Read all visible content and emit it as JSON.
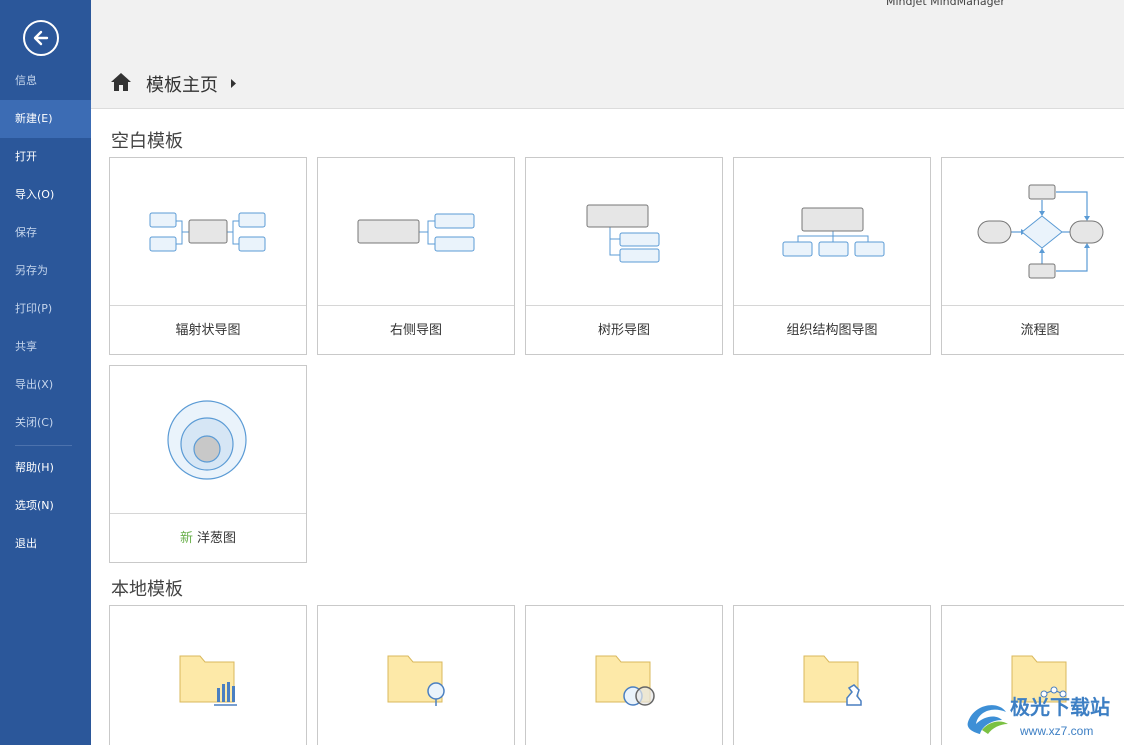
{
  "app": {
    "title": "Mindjet MindManager"
  },
  "sidebar": {
    "back_icon": "back-arrow-icon",
    "items": [
      {
        "label": "信息",
        "state": "dim"
      },
      {
        "label": "新建(E)",
        "state": "active"
      },
      {
        "label": "打开",
        "state": "normal"
      },
      {
        "label": "导入(O)",
        "state": "normal"
      },
      {
        "label": "保存",
        "state": "dim"
      },
      {
        "label": "另存为",
        "state": "dim"
      },
      {
        "label": "打印(P)",
        "state": "dim"
      },
      {
        "label": "共享",
        "state": "dim"
      },
      {
        "label": "导出(X)",
        "state": "dim"
      },
      {
        "label": "关闭(C)",
        "state": "dim"
      },
      {
        "label": "帮助(H)",
        "state": "normal"
      },
      {
        "label": "选项(N)",
        "state": "normal"
      },
      {
        "label": "退出",
        "state": "normal"
      }
    ]
  },
  "header": {
    "breadcrumb": "模板主页",
    "home_icon": "home-icon"
  },
  "blank_templates": {
    "title": "空白模板",
    "cards": [
      {
        "label": "辐射状导图",
        "icon": "radial-map-icon"
      },
      {
        "label": "右侧导图",
        "icon": "right-map-icon"
      },
      {
        "label": "树形导图",
        "icon": "tree-map-icon"
      },
      {
        "label": "组织结构图导图",
        "icon": "org-chart-icon"
      },
      {
        "label": "流程图",
        "icon": "flowchart-icon"
      },
      {
        "label": "洋葱图",
        "tag": "新",
        "icon": "onion-diagram-icon"
      }
    ]
  },
  "local_templates": {
    "title": "本地模板",
    "folders": [
      {
        "icon": "folder-chart-icon"
      },
      {
        "icon": "folder-balloon-icon"
      },
      {
        "icon": "folder-venn-icon"
      },
      {
        "icon": "folder-chess-icon"
      },
      {
        "icon": "folder-network-icon"
      }
    ]
  },
  "watermark": {
    "text": "极光下载站",
    "url": "www.xz7.com"
  },
  "colors": {
    "sidebar": "#2b579a",
    "sidebar_active": "#3c6cb4",
    "node_blue": "#5b9bd5",
    "folder": "#fde9a8"
  }
}
